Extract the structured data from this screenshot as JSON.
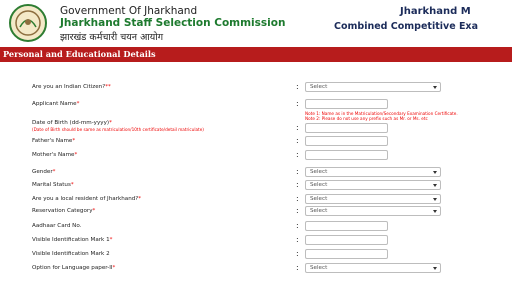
{
  "header": {
    "org_line1": "Government Of Jharkhand",
    "org_line2": "Jharkhand Staff Selection Commission",
    "org_line3": "झारखंड कर्मचारी चयन आयोग",
    "right_line1": "Jharkhand M",
    "right_line2": "Combined Competitive Exa"
  },
  "section": {
    "title": "Personal and Educational Details"
  },
  "fields": {
    "citizen": {
      "label": "Are you an Indian Citizen?",
      "value": "Select"
    },
    "name": {
      "label": "Applicant Name",
      "note1": "Note 1: Name as in the Matriculation/Secondary Examination Certificate.",
      "note2": "Note 2: Please do not use any prefix such as Mr. or Ms. etc"
    },
    "dob": {
      "label": "Date of Birth (dd-mm-yyyy)",
      "sub": "(Date of Birth should be same as matriculation/10th certificate/detail matriculate)"
    },
    "father": {
      "label": "Father's Name"
    },
    "mother": {
      "label": "Mother's Name"
    },
    "gender": {
      "label": "Gender",
      "value": "Select"
    },
    "marital": {
      "label": "Marital Status",
      "value": "Select"
    },
    "resident": {
      "label": "Are you a local resident of Jharkhand?",
      "value": "Select"
    },
    "category": {
      "label": "Reservation Category",
      "value": "Select"
    },
    "aadhaar": {
      "label": "Aadhaar Card No."
    },
    "mark1": {
      "label": "Visible Identification Mark 1"
    },
    "mark2": {
      "label": "Visible Identification Mark 2"
    },
    "language": {
      "label": "Option for Language paper-II",
      "value": "Select"
    }
  },
  "required_marker": "*",
  "colon": ":",
  "colors": {
    "bar": "#b71c1c",
    "title_green": "#1d7a2e",
    "title_navy": "#1c2c5a",
    "required": "#e00000"
  },
  "icons": {
    "emblem": "jharkhand-emblem",
    "select_arrow": "chevron-down-icon"
  }
}
